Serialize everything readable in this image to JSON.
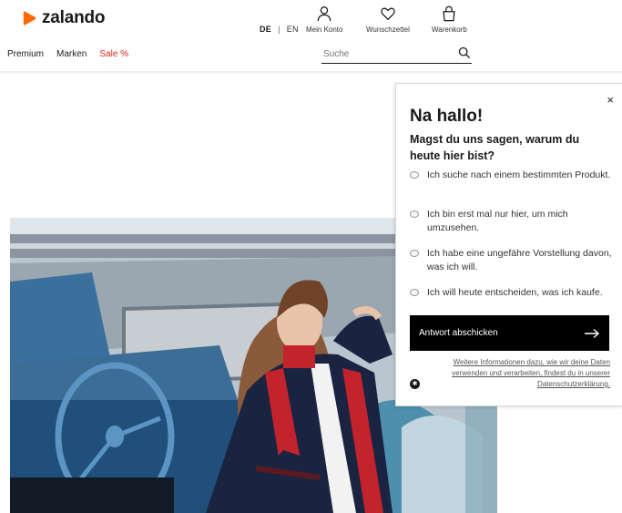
{
  "header": {
    "logo_text": "zalando",
    "languages": [
      "DE",
      "EN"
    ],
    "account_label": "Mein Konto",
    "wishlist_label": "Wunschzettel",
    "cart_label": "Warenkorb"
  },
  "nav": {
    "items": [
      "Premium",
      "Marken",
      "Sale %"
    ]
  },
  "search": {
    "placeholder": "Suche"
  },
  "popup": {
    "close": "×",
    "title": "Na hallo!",
    "question": "Magst du uns sagen, warum du heute hier bist?",
    "options": [
      "Ich suche nach einem bestimmten Produkt.",
      "Ich bin erst mal nur hier, um mich umzusehen.",
      "Ich habe eine ungefähre Vorstellung davon, was ich will.",
      "Ich will heute entscheiden, was ich kaufe."
    ],
    "submit_label": "Antwort abschicken",
    "info_text": "Weitere Informationen dazu, wie wir deine Daten verwenden und verarbeiten, findest du in unserer Datenschutzerklärung."
  },
  "colors": {
    "brand": "#ff6900",
    "sale": "#e2231a",
    "button": "#000000"
  }
}
